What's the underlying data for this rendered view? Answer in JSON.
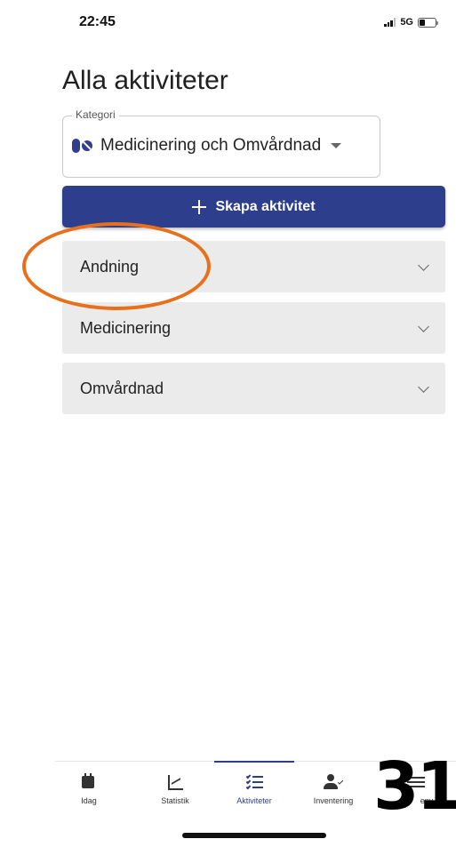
{
  "status_bar": {
    "time": "22:45",
    "network": "5G"
  },
  "page": {
    "title": "Alla aktiviteter"
  },
  "category": {
    "legend": "Kategori",
    "value": "Medicinering och Omvårdnad"
  },
  "create_button": {
    "label": "Skapa aktivitet"
  },
  "accordion": {
    "items": [
      {
        "label": "Andning"
      },
      {
        "label": "Medicinering"
      },
      {
        "label": "Omvårdnad"
      }
    ]
  },
  "bottom_nav": {
    "items": [
      {
        "label": "Idag"
      },
      {
        "label": "Statistik"
      },
      {
        "label": "Aktiviteter"
      },
      {
        "label": "Inventering"
      },
      {
        "label": "eny"
      }
    ],
    "active": "Aktiviteter"
  },
  "overlay": {
    "number": "31"
  },
  "colors": {
    "primary": "#2d3e8c",
    "highlight": "#e8701c",
    "accordion_bg": "#ebebeb"
  }
}
